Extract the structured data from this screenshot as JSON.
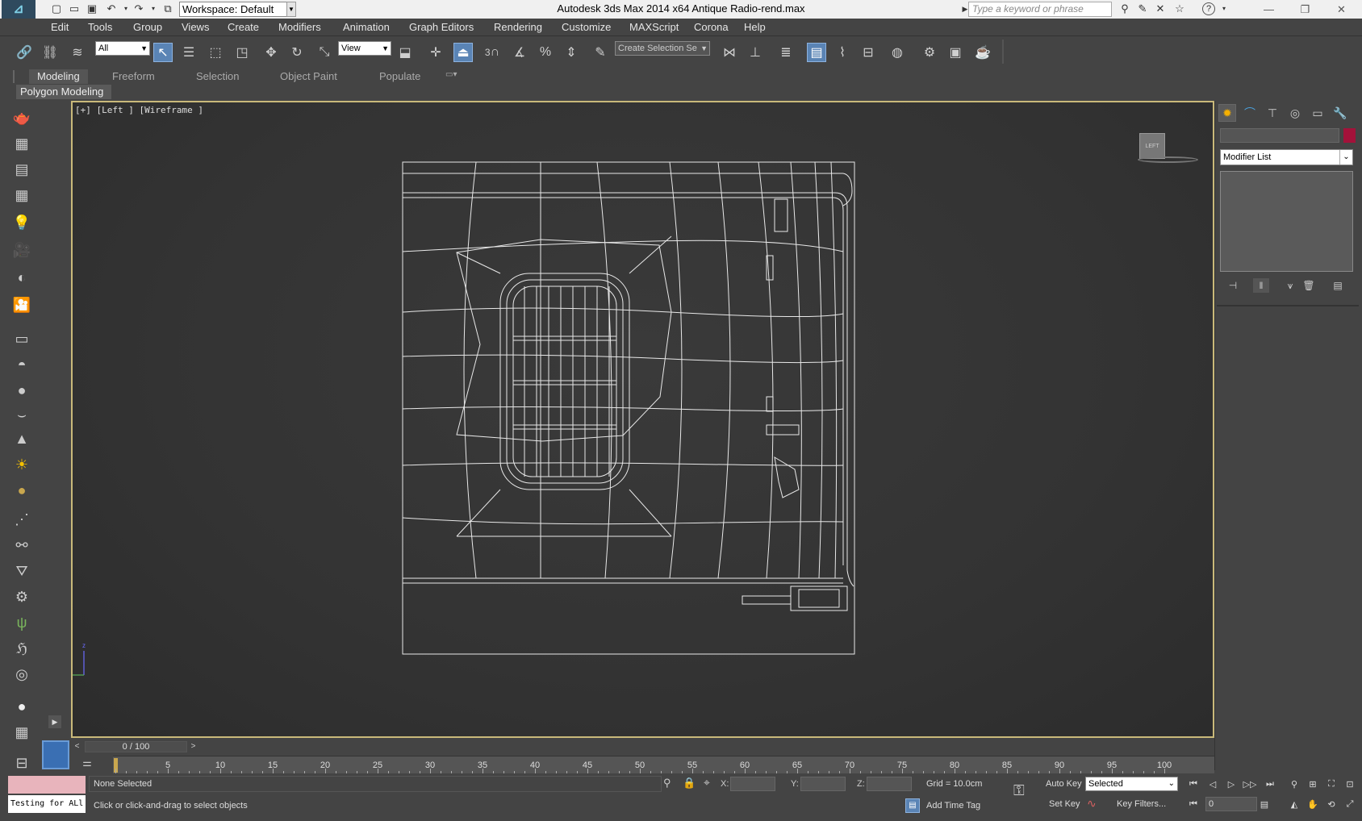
{
  "titlebar": {
    "title": "Autodesk 3ds Max  2014 x64      Antique Radio-rend.max",
    "workspace": "Workspace: Default",
    "search_placeholder": "Type a keyword or phrase",
    "window_controls": [
      "minimize",
      "restore",
      "close"
    ]
  },
  "menu": {
    "items": [
      "Edit",
      "Tools",
      "Group",
      "Views",
      "Create",
      "Modifiers",
      "Animation",
      "Graph Editors",
      "Rendering",
      "Customize",
      "MAXScript",
      "Corona",
      "Help"
    ]
  },
  "toolbar": {
    "filter_value": "All",
    "coord_system": "View",
    "named_selection": "Create Selection Se",
    "snap_label": "3"
  },
  "ribbon": {
    "tabs": [
      "Modeling",
      "Freeform",
      "Selection",
      "Object Paint",
      "Populate"
    ],
    "active_tab": "Modeling",
    "panel_label": "Polygon Modeling"
  },
  "viewport": {
    "label": "[+] [Left ] [Wireframe ]",
    "viewcube_label": "LEFT"
  },
  "command_panel": {
    "modifier_list": "Modifier List",
    "object_color": "#a3123a"
  },
  "timeline": {
    "frame_display": "0 / 100",
    "ticks": [
      5,
      10,
      15,
      20,
      25,
      30,
      35,
      40,
      45,
      50,
      55,
      60,
      65,
      70,
      75,
      80,
      85,
      90,
      95,
      100
    ]
  },
  "status": {
    "maxscript_text": "Testing for ALl",
    "selection": "None Selected",
    "prompt": "Click or click-and-drag to select objects",
    "x_label": "X:",
    "y_label": "Y:",
    "z_label": "Z:",
    "grid": "Grid = 10.0cm",
    "add_time_tag": "Add Time Tag",
    "auto_key": "Auto Key",
    "set_key": "Set Key",
    "selected_dropdown": "Selected",
    "key_filters": "Key Filters...",
    "current_frame": "0"
  }
}
